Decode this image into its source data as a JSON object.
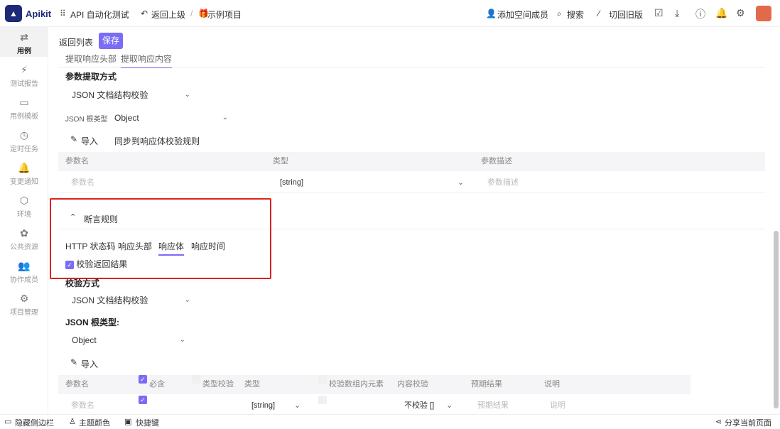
{
  "header": {
    "app_name": "Apikit",
    "module": "API 自动化测试",
    "back": "返回上级",
    "separator": "/",
    "project": "示例项目",
    "add_member": "添加空间成员",
    "search": "搜索",
    "old_version": "切回旧版"
  },
  "sidebar": {
    "items": [
      {
        "label": "用例",
        "icon": "⇄"
      },
      {
        "label": "测试报告",
        "icon": "⚡"
      },
      {
        "label": "用例模板",
        "icon": "▭"
      },
      {
        "label": "定时任务",
        "icon": "◷"
      },
      {
        "label": "变更通知",
        "icon": "🔔"
      },
      {
        "label": "环境",
        "icon": "⬡"
      },
      {
        "label": "公共资源",
        "icon": "✿"
      },
      {
        "label": "协作成员",
        "icon": "👥"
      },
      {
        "label": "项目管理",
        "icon": "⚙"
      }
    ]
  },
  "toolbar": {
    "back_list": "返回列表",
    "save": "保存"
  },
  "extract": {
    "tabs": [
      "提取响应头部",
      "提取响应内容"
    ],
    "method_label": "参数提取方式",
    "method_value": "JSON 文档结构校验",
    "root_type_label": "JSON 根类型:",
    "root_type_value": "Object",
    "import": "导入",
    "sync": "同步到响应体校验规则",
    "columns": [
      "参数名",
      "类型",
      "参数描述"
    ],
    "row": {
      "name_placeholder": "参数名",
      "type": "[string]",
      "desc_placeholder": "参数描述"
    }
  },
  "assert": {
    "title": "断言规则",
    "tabs": [
      "HTTP 状态码",
      "响应头部",
      "响应体",
      "响应时间"
    ],
    "checkbox_label": "校验返回结果",
    "method_label": "校验方式",
    "method_value": "JSON 文档结构校验",
    "root_type_label": "JSON 根类型:",
    "root_type_value": "Object",
    "import": "导入",
    "columns": [
      "参数名",
      "必含",
      "类型校验",
      "类型",
      "校验数组内元素",
      "内容校验",
      "预期结果",
      "说明"
    ],
    "row": {
      "name_placeholder": "参数名",
      "type": "[string]",
      "content_check": "不校验 []",
      "expected_placeholder": "预期结果",
      "desc_placeholder": "说明"
    }
  },
  "footer": {
    "hide_sidebar": "隐藏侧边栏",
    "theme": "主题颜色",
    "shortcuts": "快捷键",
    "share": "分享当前页面"
  },
  "colors": {
    "accent": "#7b6cf6",
    "highlight": "#e02020"
  }
}
